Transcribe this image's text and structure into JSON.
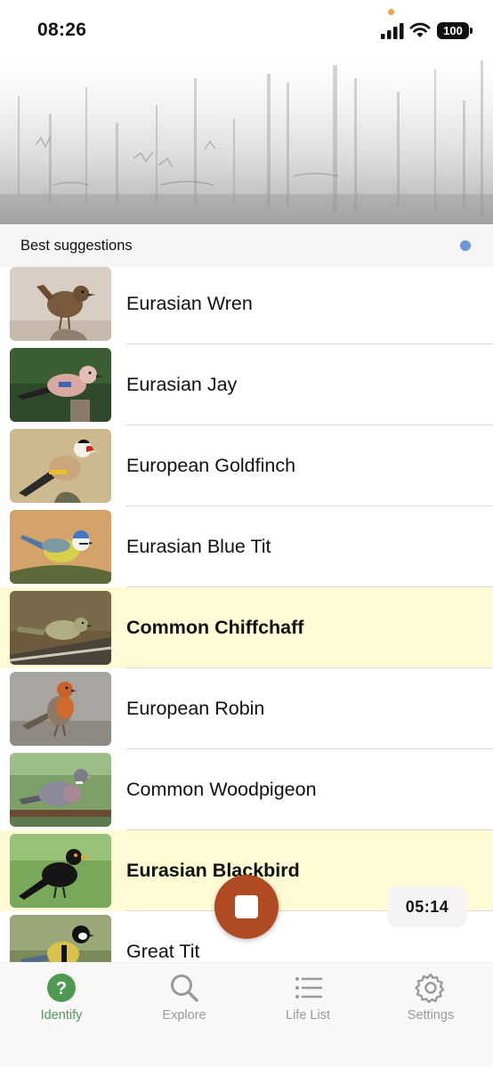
{
  "status_bar": {
    "time": "08:26",
    "battery": "100"
  },
  "spectrogram": {
    "icon": "audio-spectrogram"
  },
  "suggestions": {
    "title": "Best suggestions",
    "indicator_color": "#6c96d6"
  },
  "species": [
    {
      "name": "Eurasian Wren",
      "highlighted": false
    },
    {
      "name": "Eurasian Jay",
      "highlighted": false
    },
    {
      "name": "European Goldfinch",
      "highlighted": false
    },
    {
      "name": "Eurasian Blue Tit",
      "highlighted": false
    },
    {
      "name": "Common Chiffchaff",
      "highlighted": true
    },
    {
      "name": "European Robin",
      "highlighted": false
    },
    {
      "name": "Common Woodpigeon",
      "highlighted": false
    },
    {
      "name": "Eurasian Blackbird",
      "highlighted": true
    },
    {
      "name": "Great Tit",
      "highlighted": false
    }
  ],
  "recorder": {
    "timer": "05:14",
    "button_color": "#b04a22"
  },
  "tabs": [
    {
      "label": "Identify",
      "icon": "question-circle-icon",
      "active": true
    },
    {
      "label": "Explore",
      "icon": "search-icon",
      "active": false
    },
    {
      "label": "Life List",
      "icon": "list-icon",
      "active": false
    },
    {
      "label": "Settings",
      "icon": "gear-icon",
      "active": false
    }
  ],
  "colors": {
    "accent": "#4e9a52",
    "highlight_row": "#fefbd4"
  }
}
